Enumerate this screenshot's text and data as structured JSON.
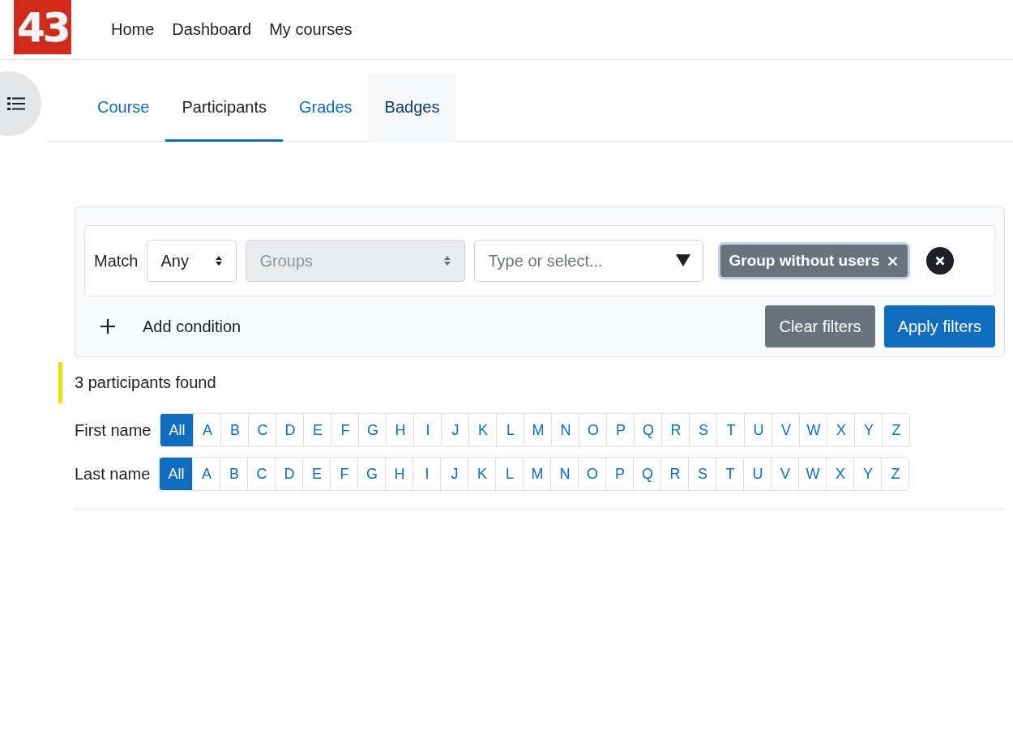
{
  "navbar": {
    "logo": "43",
    "links": [
      "Home",
      "Dashboard",
      "My courses"
    ]
  },
  "tabs": [
    {
      "label": "Course",
      "selected": false,
      "highlighted": false
    },
    {
      "label": "Participants",
      "selected": true,
      "highlighted": false
    },
    {
      "label": "Grades",
      "selected": false,
      "highlighted": false
    },
    {
      "label": "Badges",
      "selected": false,
      "highlighted": true
    }
  ],
  "filter": {
    "match_label": "Match",
    "match_value": "Any",
    "type_value": "Groups",
    "type_disabled": true,
    "search_placeholder": "Type or select...",
    "chips": [
      "Group without users"
    ],
    "add_condition": "Add condition",
    "buttons": [
      {
        "label": "Clear filters",
        "kind": "secondary"
      },
      {
        "label": "Apply filters",
        "kind": "primary"
      }
    ]
  },
  "result": "3 participants found",
  "initials": [
    {
      "label": "First name",
      "letters": [
        {
          "text": "All",
          "selected": true
        },
        {
          "text": "A",
          "selected": false
        },
        {
          "text": "B",
          "selected": false
        },
        {
          "text": "C",
          "selected": false
        },
        {
          "text": "D",
          "selected": false
        },
        {
          "text": "E",
          "selected": false
        },
        {
          "text": "F",
          "selected": false
        },
        {
          "text": "G",
          "selected": false
        },
        {
          "text": "H",
          "selected": false
        },
        {
          "text": "I",
          "selected": false
        },
        {
          "text": "J",
          "selected": false
        },
        {
          "text": "K",
          "selected": false
        },
        {
          "text": "L",
          "selected": false
        },
        {
          "text": "M",
          "selected": false
        },
        {
          "text": "N",
          "selected": false
        },
        {
          "text": "O",
          "selected": false
        },
        {
          "text": "P",
          "selected": false
        },
        {
          "text": "Q",
          "selected": false
        },
        {
          "text": "R",
          "selected": false
        },
        {
          "text": "S",
          "selected": false
        },
        {
          "text": "T",
          "selected": false
        },
        {
          "text": "U",
          "selected": false
        },
        {
          "text": "V",
          "selected": false
        },
        {
          "text": "W",
          "selected": false
        },
        {
          "text": "X",
          "selected": false
        },
        {
          "text": "Y",
          "selected": false
        },
        {
          "text": "Z",
          "selected": false
        }
      ]
    },
    {
      "label": "Last name",
      "letters": [
        {
          "text": "All",
          "selected": true
        },
        {
          "text": "A",
          "selected": false
        },
        {
          "text": "B",
          "selected": false
        },
        {
          "text": "C",
          "selected": false
        },
        {
          "text": "D",
          "selected": false
        },
        {
          "text": "E",
          "selected": false
        },
        {
          "text": "F",
          "selected": false
        },
        {
          "text": "G",
          "selected": false
        },
        {
          "text": "H",
          "selected": false
        },
        {
          "text": "I",
          "selected": false
        },
        {
          "text": "J",
          "selected": false
        },
        {
          "text": "K",
          "selected": false
        },
        {
          "text": "L",
          "selected": false
        },
        {
          "text": "M",
          "selected": false
        },
        {
          "text": "N",
          "selected": false
        },
        {
          "text": "O",
          "selected": false
        },
        {
          "text": "P",
          "selected": false
        },
        {
          "text": "Q",
          "selected": false
        },
        {
          "text": "R",
          "selected": false
        },
        {
          "text": "S",
          "selected": false
        },
        {
          "text": "T",
          "selected": false
        },
        {
          "text": "U",
          "selected": false
        },
        {
          "text": "V",
          "selected": false
        },
        {
          "text": "W",
          "selected": false
        },
        {
          "text": "X",
          "selected": false
        },
        {
          "text": "Y",
          "selected": false
        },
        {
          "text": "Z",
          "selected": false
        }
      ]
    }
  ]
}
